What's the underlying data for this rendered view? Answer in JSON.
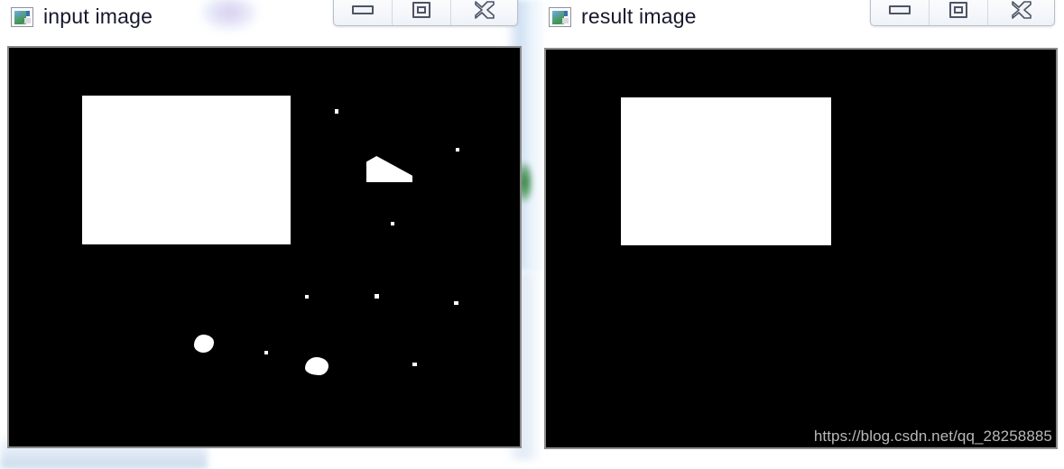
{
  "windows": [
    {
      "id": "input-window",
      "title": "input image",
      "icon": "image-app-icon",
      "controls": {
        "minimize_label": "Minimize",
        "restore_label": "Restore",
        "close_label": "Close"
      },
      "canvas": {
        "background_color": "#000000",
        "foreground_color": "#ffffff",
        "watermark": ""
      }
    },
    {
      "id": "result-window",
      "title": "result image",
      "icon": "image-app-icon",
      "controls": {
        "minimize_label": "Minimize",
        "restore_label": "Restore",
        "close_label": "Close"
      },
      "canvas": {
        "background_color": "#000000",
        "foreground_color": "#ffffff",
        "watermark": "https://blog.csdn.net/qq_28258885"
      }
    }
  ],
  "colors": {
    "window_border": "#8a8a8a",
    "title_text": "#17182c",
    "canvas_black": "#000000",
    "canvas_white": "#ffffff",
    "watermark_gray": "#b9b9b9",
    "control_glyph": "#4d5466"
  }
}
